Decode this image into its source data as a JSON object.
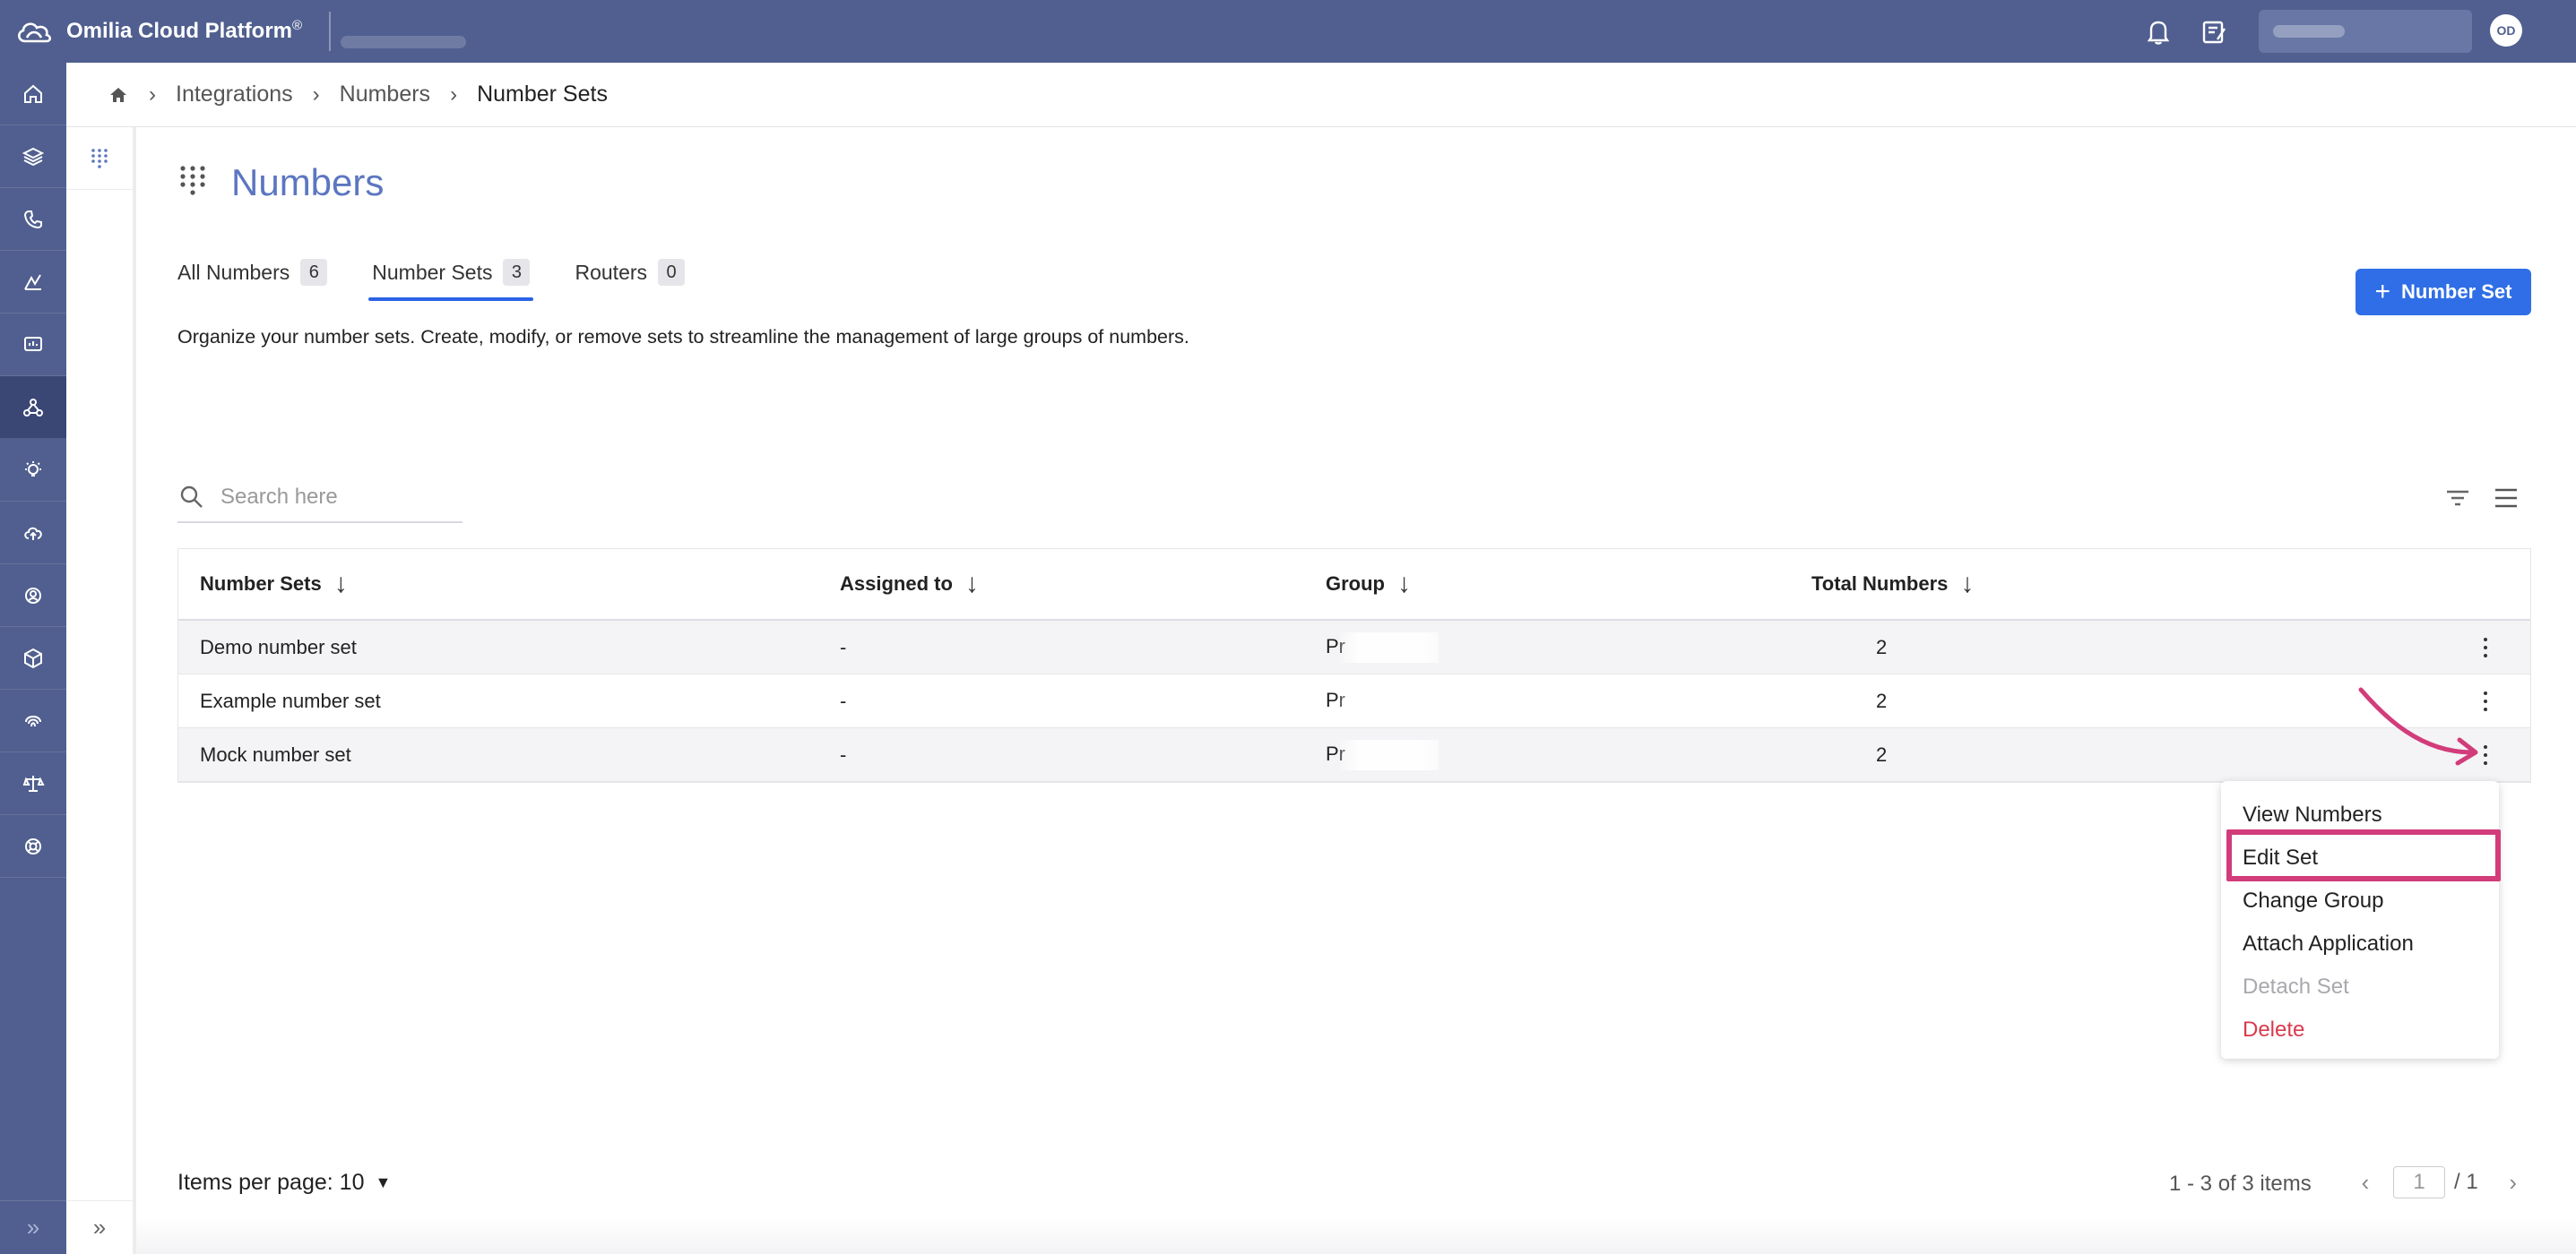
{
  "app": {
    "title": "Omilia Cloud Platform",
    "title_mark": "®",
    "user_initials": "OD"
  },
  "breadcrumb": {
    "items": [
      "Integrations",
      "Numbers"
    ],
    "current": "Number Sets"
  },
  "page": {
    "title": "Numbers",
    "description": "Organize your number sets. Create, modify, or remove sets to streamline the management of large groups of numbers."
  },
  "tabs": [
    {
      "label": "All Numbers",
      "count": "6"
    },
    {
      "label": "Number Sets",
      "count": "3"
    },
    {
      "label": "Routers",
      "count": "0"
    }
  ],
  "actions": {
    "add_label": "Number Set"
  },
  "search": {
    "placeholder": "Search here"
  },
  "table": {
    "columns": [
      "Number Sets",
      "Assigned to",
      "Group",
      "Total Numbers"
    ],
    "rows": [
      {
        "name": "Demo number set",
        "assigned": "-",
        "group": "Pr",
        "total": "2"
      },
      {
        "name": "Example number set",
        "assigned": "-",
        "group": "Pr",
        "total": "2"
      },
      {
        "name": "Mock number set",
        "assigned": "-",
        "group": "Pr",
        "total": "2"
      }
    ]
  },
  "context_menu": {
    "items": [
      "View Numbers",
      "Edit Set",
      "Change Group",
      "Attach Application",
      "Detach Set",
      "Delete"
    ],
    "highlighted": "Edit Set",
    "disabled": "Detach Set"
  },
  "footer": {
    "items_per_page_label": "Items per page:",
    "items_per_page_value": "10",
    "summary": "1 - 3 of 3 items",
    "current_page": "1",
    "total_pages": "/ 1"
  },
  "colors": {
    "nav_bg": "#505f8f",
    "accent_blue": "#2f6ee6",
    "title_blue": "#5c76c0",
    "annotation_pink": "#d23c7a",
    "danger_red": "#d93a4e"
  }
}
